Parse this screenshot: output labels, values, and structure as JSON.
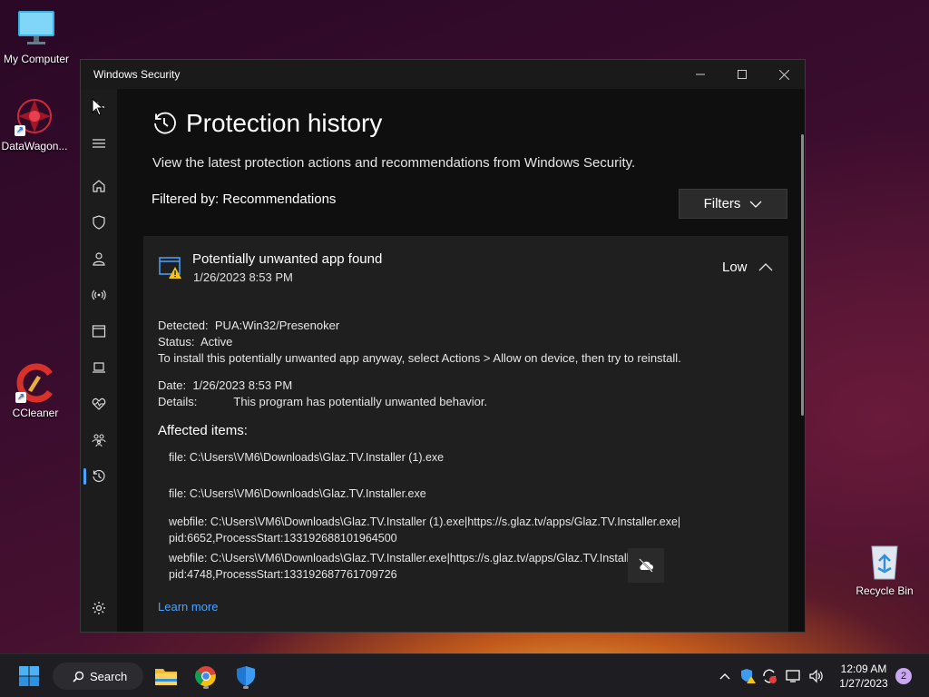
{
  "desktop": {
    "icons": [
      {
        "label": "My Computer"
      },
      {
        "label": "DataWagon..."
      },
      {
        "label": "CCleaner"
      },
      {
        "label": "Recycle Bin"
      }
    ]
  },
  "window": {
    "title": "Windows Security",
    "page_title": "Protection history",
    "subtitle": "View the latest protection actions and recommendations from Windows Security.",
    "filtered_by": "Filtered by: Recommendations",
    "filters_button": "Filters",
    "card": {
      "name": "Potentially unwanted app found",
      "date": "1/26/2023 8:53 PM",
      "severity": "Low",
      "detected_label": "Detected:",
      "detected_value": "PUA:Win32/Presenoker",
      "status_label": "Status:",
      "status_value": "Active",
      "instruction": "To install this potentially unwanted app anyway, select Actions > Allow on device, then try to reinstall.",
      "date_label": "Date:",
      "date_value": "1/26/2023 8:53 PM",
      "details_label": "Details:",
      "details_value": "This program has potentially unwanted behavior.",
      "affected_title": "Affected items:",
      "items": [
        "file: C:\\Users\\VM6\\Downloads\\Glaz.TV.Installer (1).exe",
        "file: C:\\Users\\VM6\\Downloads\\Glaz.TV.Installer.exe",
        "webfile: C:\\Users\\VM6\\Downloads\\Glaz.TV.Installer (1).exe|https://s.glaz.tv/apps/Glaz.TV.Installer.exe|",
        "pid:6652,ProcessStart:133192688101964500",
        "webfile: C:\\Users\\VM6\\Downloads\\Glaz.TV.Installer.exe|https://s.glaz.tv/apps/Glaz.TV.Installer.exe|",
        "pid:4748,ProcessStart:133192687761709726"
      ],
      "learn_more": "Learn more"
    }
  },
  "taskbar": {
    "search_label": "Search",
    "time": "12:09 AM",
    "date": "1/27/2023",
    "notification_count": "2"
  },
  "colors": {
    "accent": "#4aa3ff",
    "warning": "#f5c518",
    "window_bg": "#0f0f0f",
    "card_bg": "#1f1f1f"
  }
}
